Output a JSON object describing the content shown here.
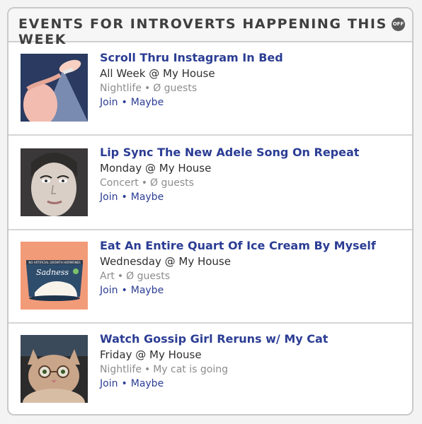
{
  "header": {
    "title": "EVENTS FOR INTROVERTS HAPPENING THIS WEEK",
    "badge": "OFF"
  },
  "events": [
    {
      "title": "Scroll Thru Instagram In Bed",
      "when": "All Week @ My House",
      "category": "Nightlife",
      "guests": "Ø guests",
      "join": "Join",
      "maybe": "Maybe",
      "thumb_icon": "phone-in-bed-image"
    },
    {
      "title": "Lip Sync The New Adele Song On Repeat",
      "when": "Monday @ My House",
      "category": "Concert",
      "guests": "Ø guests",
      "join": "Join",
      "maybe": "Maybe",
      "thumb_icon": "adele-face-image"
    },
    {
      "title": "Eat An Entire Quart Of Ice Cream By Myself",
      "when": "Wednesday @ My House",
      "category": "Art",
      "guests": "Ø guests",
      "join": "Join",
      "maybe": "Maybe",
      "thumb_icon": "ice-cream-carton-image",
      "carton_text": "Sadness",
      "carton_band": "NO ARTIFICIAL GROWTH HORMONES"
    },
    {
      "title": "Watch Gossip Girl Reruns w/ My Cat",
      "when": "Friday @ My House",
      "category": "Nightlife",
      "guests": "My cat is going",
      "join": "Join",
      "maybe": "Maybe",
      "thumb_icon": "cat-with-glasses-image"
    }
  ],
  "colors": {
    "link": "#2b3d94",
    "meta": "#8d8d8d",
    "border": "#c9c9c9"
  }
}
